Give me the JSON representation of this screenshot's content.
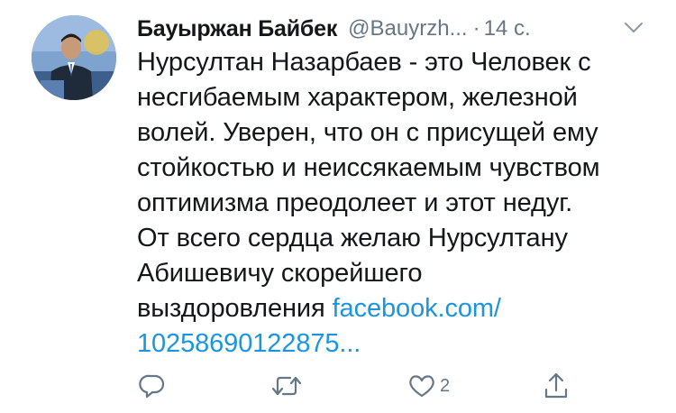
{
  "tweet": {
    "display_name": "Бауыржан Байбек",
    "handle": "@Bauyrzh...",
    "separator": "·",
    "time": "14 с.",
    "avatar_icon": "user-avatar",
    "text_lines": [
      "Нурсултан Назарбаев - это Человек с",
      "несгибаемым характером, железной",
      "волей. Уверен, что он с присущей ему",
      "стойкостью и неиссякаемым чувством",
      "оптимизма преодолеет и этот недуг.",
      "От всего сердца желаю Нурсултану",
      "Абишевичу скорейшего"
    ],
    "last_line_text": "выздоровления ",
    "link_part1": "facebook.com/",
    "link_part2": "10258690122875..."
  },
  "actions": {
    "reply_icon": "reply-icon",
    "retweet_icon": "retweet-icon",
    "like_icon": "heart-icon",
    "like_count": "2",
    "share_icon": "share-icon"
  },
  "colors": {
    "text": "#14171a",
    "secondary": "#657786",
    "link": "#1b95e0"
  }
}
